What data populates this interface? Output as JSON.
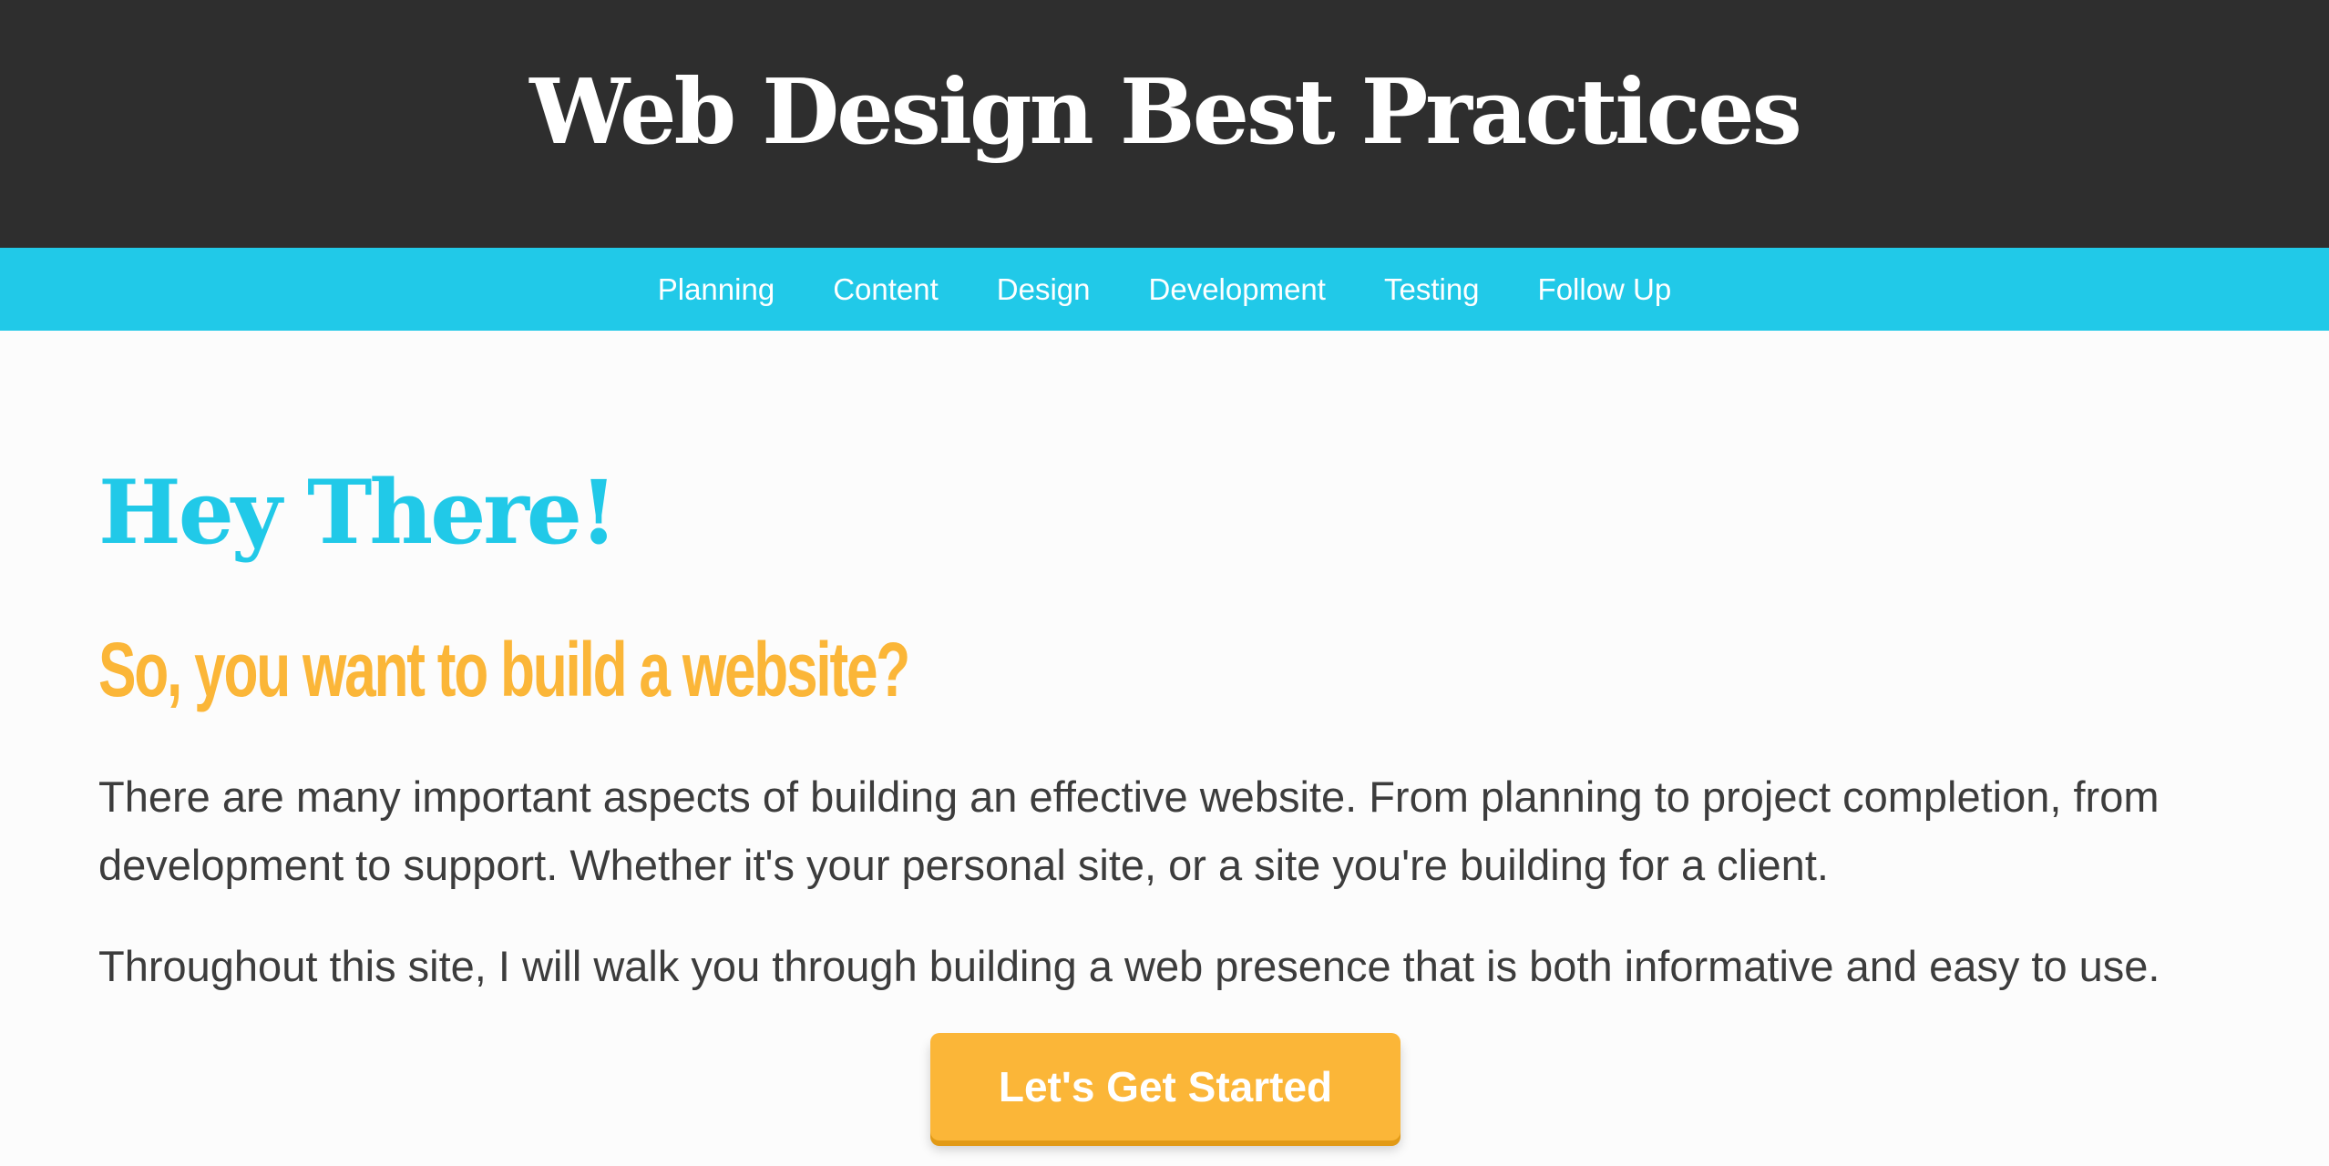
{
  "header": {
    "title": "Web Design Best Practices"
  },
  "nav": {
    "items": [
      {
        "label": "Planning"
      },
      {
        "label": "Content"
      },
      {
        "label": "Design"
      },
      {
        "label": "Development"
      },
      {
        "label": "Testing"
      },
      {
        "label": "Follow Up"
      }
    ]
  },
  "main": {
    "title": "Hey There!",
    "subtitle": "So, you want to build a website?",
    "paragraphs": [
      "There are many important aspects of building an effective website. From planning to project completion, from development to support. Whether it's your personal site, or a site you're building for a client.",
      "Throughout this site, I will walk you through building a web presence that is both informative and easy to use."
    ],
    "cta_label": "Let's Get Started"
  },
  "colors": {
    "header_bg": "#2e2e2e",
    "nav_bg": "#21c9e8",
    "accent_blue": "#21c9e8",
    "accent_orange": "#fbb638",
    "body_text": "#3c3c3c"
  }
}
